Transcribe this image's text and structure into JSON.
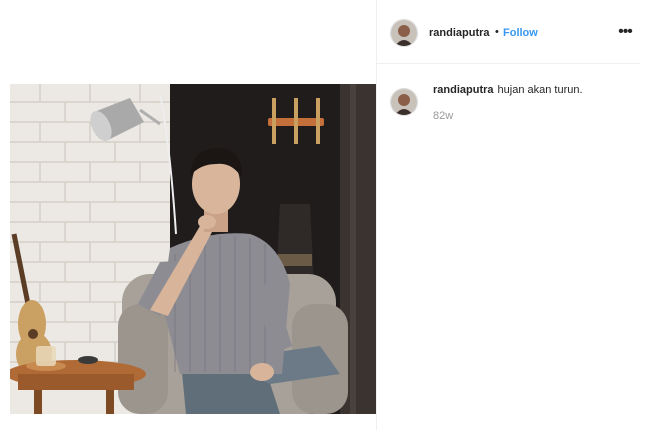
{
  "post": {
    "author": {
      "username": "randiaputra",
      "avatar_icon": "profile-avatar-icon"
    },
    "header": {
      "separator": "•",
      "follow_label": "Follow",
      "more_icon": "more-options-icon",
      "more_glyph": "•••"
    },
    "caption": {
      "username": "randiaputra",
      "text": "hujan akan turun."
    },
    "timestamp": "82w",
    "media": {
      "description_icon": "photo-man-in-armchair"
    }
  },
  "colors": {
    "follow": "#3897f0",
    "text": "#262626",
    "muted": "#999999",
    "border": "#efefef"
  }
}
